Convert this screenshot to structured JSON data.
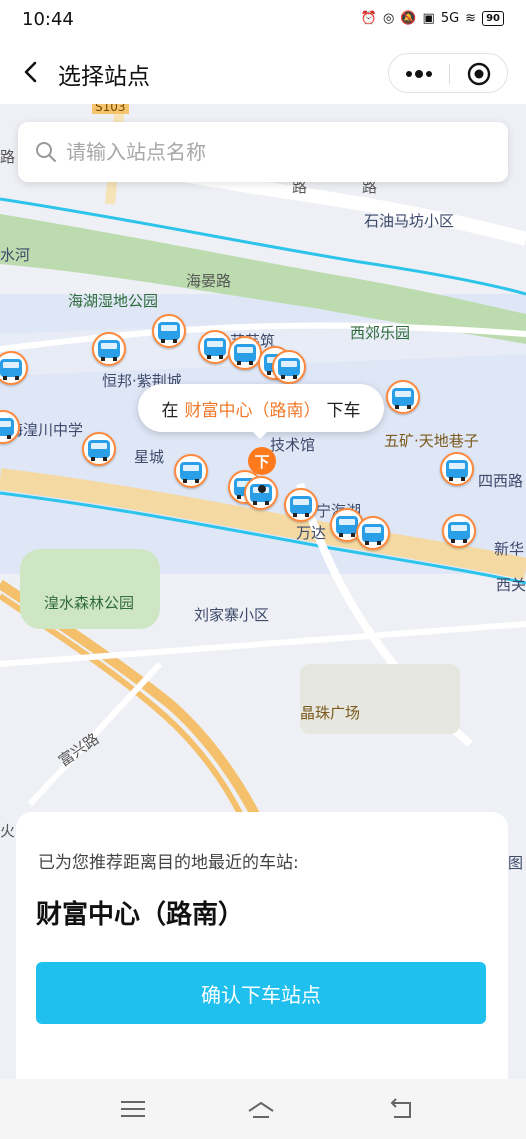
{
  "status_bar": {
    "time": "10:44",
    "network": "5G",
    "battery": "90"
  },
  "nav": {
    "title": "选择站点",
    "more_icon": "more-dots-icon",
    "close_icon": "target-close-icon"
  },
  "search": {
    "placeholder": "请输入站点名称",
    "value": ""
  },
  "map": {
    "roads": [
      {
        "text": "S103"
      },
      {
        "text": "路"
      },
      {
        "text": "路"
      },
      {
        "text": "路"
      },
      {
        "text": "海晏路"
      },
      {
        "text": "富兴路"
      },
      {
        "text": "火"
      }
    ],
    "labels": {
      "shiyou": "石油马坊小区",
      "river": "水河",
      "haihu": "海湖湿地公园",
      "xijiao": "西郊乐园",
      "hengbang": "恒邦·紫荆城",
      "yizhu": "艺芸筑",
      "haihuang": "海湟川中学",
      "xingcheng": "星城",
      "jiyuan": "技术馆",
      "wukuang": "五矿·天地巷子",
      "siximen": "四西路",
      "ningxiang": "宁海湖",
      "wanda": "万达",
      "xinhua": "新华",
      "xiguan": "西关",
      "huangshui": "湟水森林公园",
      "liujia": "刘家寨小区",
      "jingzhu": "晶珠广场",
      "edge": "图"
    }
  },
  "popup": {
    "prefix": "在",
    "station": "财富中心（路南）",
    "suffix": "下车"
  },
  "marker": {
    "label": "下"
  },
  "sheet": {
    "hint": "已为您推荐距离目的地最近的车站:",
    "station": "财富中心（路南）",
    "confirm": "确认下车站点"
  },
  "colors": {
    "accent": "#1fc0ee",
    "highlight": "#f07a2c",
    "river": "#27c2e8"
  }
}
